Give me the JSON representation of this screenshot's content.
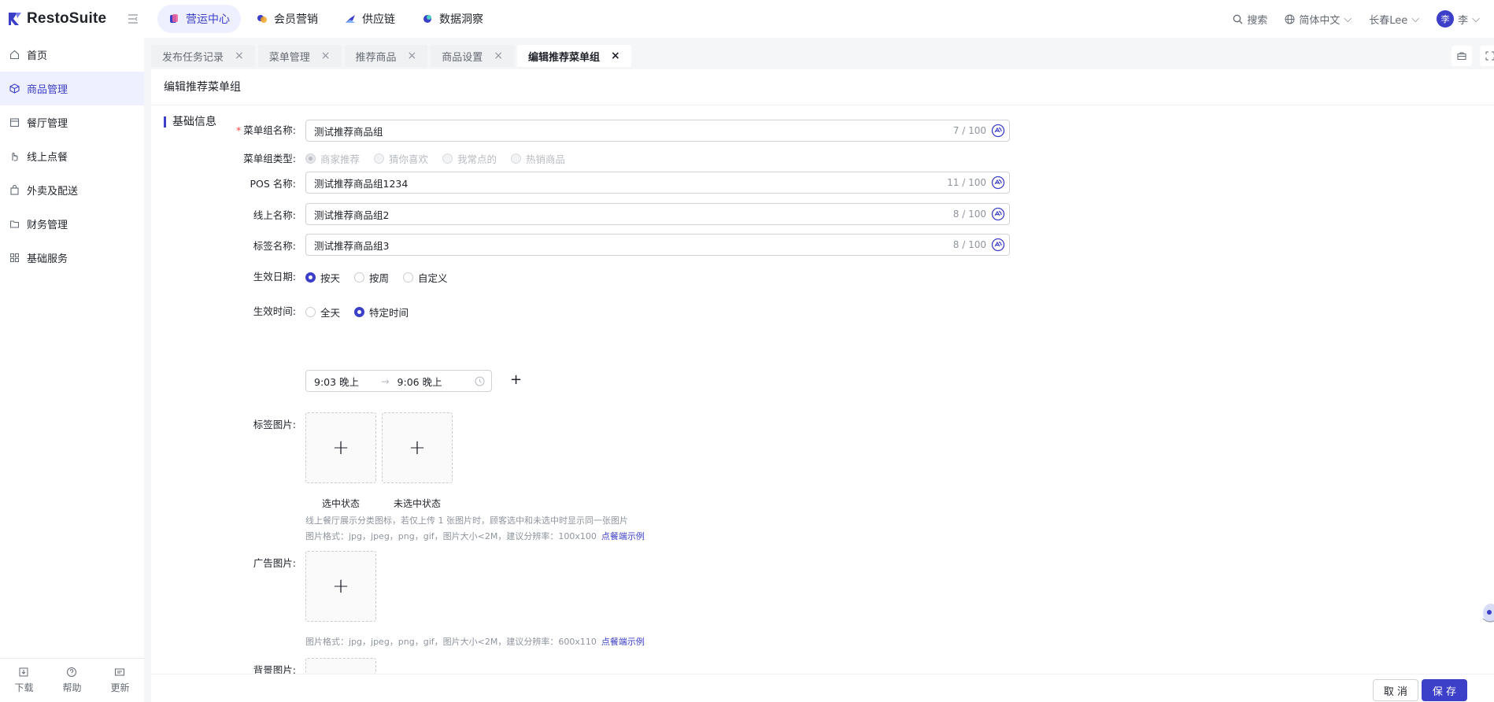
{
  "brand": {
    "name": "RestoSuite",
    "accent": "#3c3fc7"
  },
  "topnav": [
    {
      "label": "营运中心",
      "active": true
    },
    {
      "label": "会员营销",
      "active": false
    },
    {
      "label": "供应链",
      "active": false
    },
    {
      "label": "数据洞察",
      "active": false
    }
  ],
  "topright": {
    "search": "搜索",
    "language": "简体中文",
    "store": "长春Lee",
    "avatar": "李",
    "user": "李"
  },
  "sidebar": {
    "items": [
      {
        "label": "首页",
        "icon": "home-icon"
      },
      {
        "label": "商品管理",
        "icon": "cube-icon",
        "active": true
      },
      {
        "label": "餐厅管理",
        "icon": "store-icon"
      },
      {
        "label": "线上点餐",
        "icon": "hand-icon"
      },
      {
        "label": "外卖及配送",
        "icon": "bag-icon"
      },
      {
        "label": "财务管理",
        "icon": "folder-icon"
      },
      {
        "label": "基础服务",
        "icon": "grid-icon"
      }
    ],
    "bottom": {
      "download": "下载",
      "help": "帮助",
      "update": "更新"
    }
  },
  "tabs": [
    {
      "label": "发布任务记录"
    },
    {
      "label": "菜单管理"
    },
    {
      "label": "推荐商品"
    },
    {
      "label": "商品设置"
    },
    {
      "label": "编辑推荐菜单组",
      "active": true
    }
  ],
  "page": {
    "title": "编辑推荐菜单组",
    "section": "基础信息",
    "form": {
      "group_name": {
        "label": "菜单组名称:",
        "value": "测试推荐商品组",
        "count": "7 / 100"
      },
      "group_type": {
        "label": "菜单组类型:",
        "options": [
          "商家推荐",
          "猜你喜欢",
          "我常点的",
          "热销商品"
        ]
      },
      "pos_name": {
        "label": "POS 名称:",
        "value": "测试推荐商品组1234",
        "count": "11 / 100"
      },
      "online_name": {
        "label": "线上名称:",
        "value": "测试推荐商品组2",
        "count": "8 / 100"
      },
      "tag_name": {
        "label": "标签名称:",
        "value": "测试推荐商品组3",
        "count": "8 / 100"
      },
      "effective_date": {
        "label": "生效日期:",
        "options": [
          "按天",
          "按周",
          "自定义"
        ]
      },
      "effective_time": {
        "label": "生效时间:",
        "options": [
          "全天",
          "特定时间"
        ],
        "start": "9:03 晚上",
        "end": "9:06 晚上"
      },
      "tag_image": {
        "label": "标签图片:",
        "selected": "选中状态",
        "unselected": "未选中状态",
        "hint1": "线上餐厅展示分类图标，若仅上传 1 张图片时，顾客选中和未选中时显示同一张图片",
        "hint2": "图片格式：jpg，jpeg，png，gif，图片大小<2M，建议分辨率：100x100",
        "link": "点餐端示例"
      },
      "ad_image": {
        "label": "广告图片:",
        "hint": "图片格式：jpg，jpeg，png，gif，图片大小<2M，建议分辨率：600x110",
        "link": "点餐端示例"
      },
      "bg_image": {
        "label": "背景图片:"
      }
    }
  },
  "footer": {
    "cancel": "取 消",
    "save": "保 存"
  }
}
